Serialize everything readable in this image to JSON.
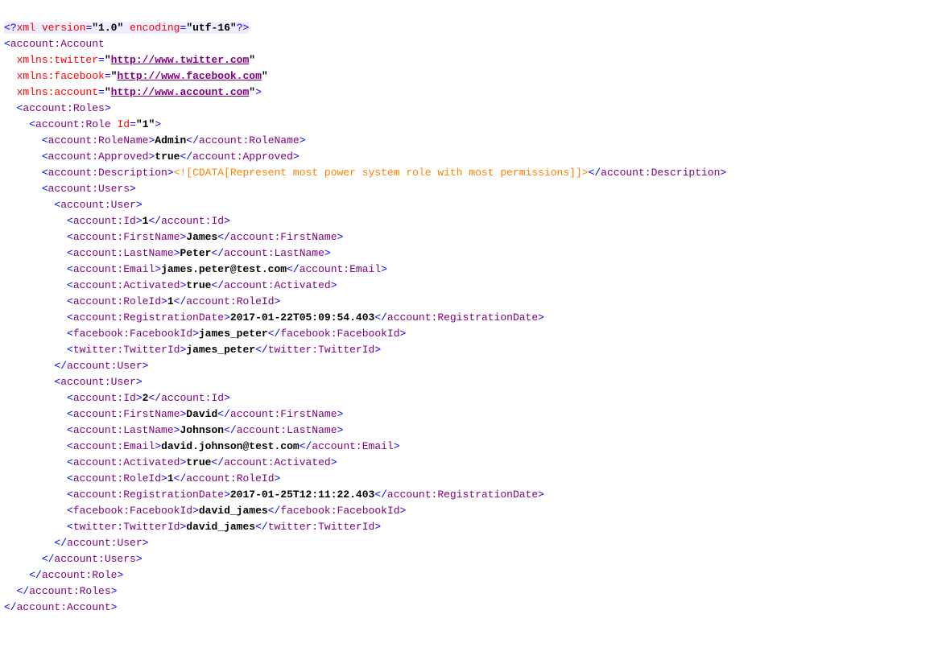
{
  "xml_decl": {
    "version": "1.0",
    "encoding": "utf-16"
  },
  "root": "account:Account",
  "namespaces": {
    "twitter": "http://www.twitter.com",
    "facebook": "http://www.facebook.com",
    "account": "http://www.account.com"
  },
  "roles_tag": "account:Roles",
  "role_tag": "account:Role",
  "role_id_attr": "Id",
  "role_id_val": "1",
  "role_name_tag": "account:RoleName",
  "role_name_val": "Admin",
  "approved_tag": "account:Approved",
  "approved_val": "true",
  "description_tag": "account:Description",
  "description_cdata": "<![CDATA[Represent most power system role with most permissions]]>",
  "users_tag": "account:Users",
  "user_tag": "account:User",
  "fields": {
    "id": "account:Id",
    "first": "account:FirstName",
    "last": "account:LastName",
    "email": "account:Email",
    "activated": "account:Activated",
    "roleid": "account:RoleId",
    "regdate": "account:RegistrationDate",
    "fb": "facebook:FacebookId",
    "tw": "twitter:TwitterId"
  },
  "users": [
    {
      "id": "1",
      "first": "James",
      "last": "Peter",
      "email": "james.peter@test.com",
      "activated": "true",
      "roleid": "1",
      "regdate": "2017-01-22T05:09:54.403",
      "fb": "james_peter",
      "tw": "james_peter"
    },
    {
      "id": "2",
      "first": "David",
      "last": "Johnson",
      "email": "david.johnson@test.com",
      "activated": "true",
      "roleid": "1",
      "regdate": "2017-01-25T12:11:22.403",
      "fb": "david_james",
      "tw": "david_james"
    }
  ]
}
